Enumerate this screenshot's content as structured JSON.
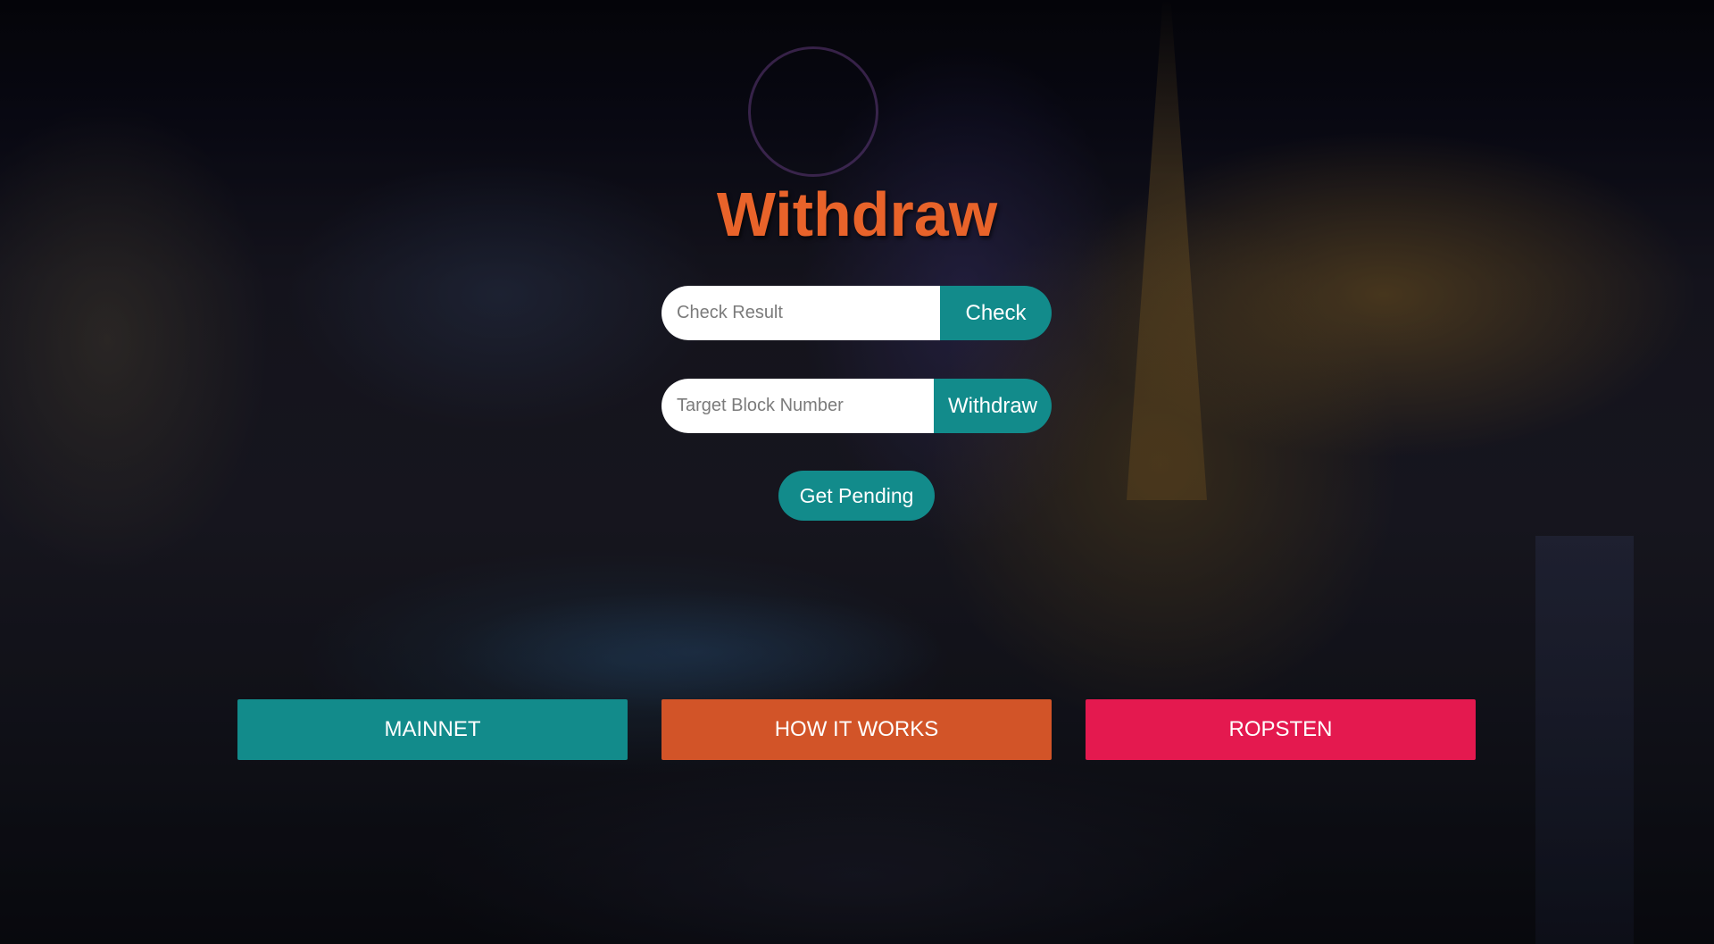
{
  "header": {
    "title": "Withdraw"
  },
  "check_form": {
    "placeholder": "Check Result",
    "button_label": "Check"
  },
  "withdraw_form": {
    "placeholder": "Target Block Number",
    "button_label": "Withdraw"
  },
  "pending": {
    "button_label": "Get Pending"
  },
  "nav": {
    "mainnet_label": "MAINNET",
    "how_it_works_label": "HOW IT WORKS",
    "ropsten_label": "ROPSTEN"
  },
  "colors": {
    "title": "#e8632a",
    "teal": "#128b8b",
    "orange": "#d25428",
    "pink": "#e4194f"
  }
}
